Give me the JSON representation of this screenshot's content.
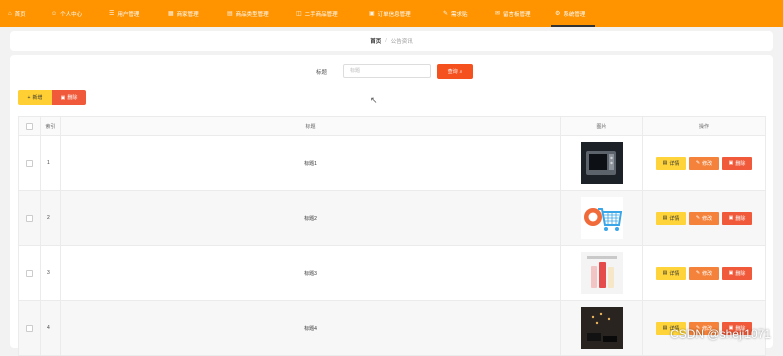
{
  "nav": [
    {
      "label": "首页",
      "icon": "home-icon",
      "glyph": "⌂"
    },
    {
      "label": "个人中心",
      "icon": "user-icon",
      "glyph": "☺"
    },
    {
      "label": "用户管理",
      "icon": "users-icon",
      "glyph": "☰"
    },
    {
      "label": "商家管理",
      "icon": "shop-icon",
      "glyph": "▦"
    },
    {
      "label": "商品类型管理",
      "icon": "category-icon",
      "glyph": "▤"
    },
    {
      "label": "二手商品管理",
      "icon": "goods-icon",
      "glyph": "◫"
    },
    {
      "label": "订单信息管理",
      "icon": "order-icon",
      "glyph": "▣"
    },
    {
      "label": "需求贴",
      "icon": "post-icon",
      "glyph": "✎"
    },
    {
      "label": "留言板管理",
      "icon": "message-icon",
      "glyph": "✉"
    },
    {
      "label": "系统管理",
      "icon": "settings-icon",
      "glyph": "⚙",
      "active": true
    }
  ],
  "breadcrumb": {
    "home": "首页",
    "separator": "/",
    "current": "公告资讯"
  },
  "search": {
    "label": "标题",
    "placeholder": "标题",
    "button": "查询"
  },
  "toolbar": {
    "add": "新增",
    "delete": "删除"
  },
  "table": {
    "headers": {
      "index": "索引",
      "title": "标题",
      "image": "图片",
      "actions": "操作"
    },
    "rows": [
      {
        "index": "1",
        "title": "标题1",
        "image": "kitchen-appliance-image"
      },
      {
        "index": "2",
        "title": "标题2",
        "image": "shopping-cart-image"
      },
      {
        "index": "3",
        "title": "标题3",
        "image": "beverage-bottles-image"
      },
      {
        "index": "4",
        "title": "标题4",
        "image": "decor-product-image"
      }
    ],
    "row_actions": {
      "detail": "详情",
      "edit": "修改",
      "delete": "删除"
    }
  },
  "watermark": "CSDN @sheji1071",
  "colors": {
    "nav": "#ff9300",
    "primary": "#f4511e",
    "add": "#ffcf33",
    "danger": "#f05a3a",
    "edit": "#f4823a",
    "detail": "#ffd43b"
  }
}
